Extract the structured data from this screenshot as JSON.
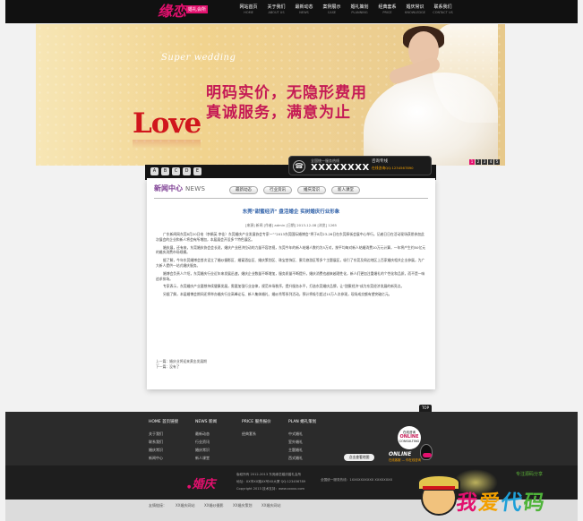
{
  "brand": {
    "logo_script": "缘恋",
    "logo_tag": "婚礼会所",
    "accent": "#e3106e"
  },
  "nav": [
    {
      "cn": "网站首页",
      "en": "HOME"
    },
    {
      "cn": "关于我们",
      "en": "ABOUT US"
    },
    {
      "cn": "最新动态",
      "en": "NEWS"
    },
    {
      "cn": "案例展示",
      "en": "CASE"
    },
    {
      "cn": "婚礼策划",
      "en": "PLANNING"
    },
    {
      "cn": "经典套系",
      "en": "PRICE"
    },
    {
      "cn": "婚庆常识",
      "en": "KNOWLEDGE"
    },
    {
      "cn": "联系我们",
      "en": "CONTACT US"
    }
  ],
  "banner": {
    "super": "Super wedding",
    "line1": "明码实价，无隐形费用",
    "line2": "真诚服务，满意为止",
    "love": "Love",
    "pager": [
      "1",
      "2",
      "3",
      "4",
      "5"
    ]
  },
  "strip": {
    "icons": [
      "A",
      "B",
      "C",
      "D",
      "E"
    ],
    "worktime_label": "全年无休 • WORK TIME",
    "worktime_hours": "AM.8:00-PM.8:00",
    "hotline_label": "全国统一服务热线",
    "hotline_number": "XXXXXXXX",
    "ask_label": "咨询专线",
    "qq_text": "在线咨询QQ:1234567890"
  },
  "news": {
    "title_cn": "新闻中心",
    "title_en": "NEWS",
    "tabs": [
      "最新动态",
      "行业资讯",
      "婚庆常识",
      "新人课堂"
    ],
    "article_title": "东莞\"甜蜜经济\" 盘活婚企 实树婚庆行业形象",
    "article_meta": "[来源] 新闻  [作者] admin  [日期] 2013-12-08  [浏览] 1265",
    "paragraphs": [
      "广东新闻网东莞8月20日电（李娟英 李佳）东莞婚庆产业发展协会专家一”“2013东莞国际婚博会”将于8月23-26日在东莞厚街会展中心举行。记者日日在活动现场获悉参加此次展会的企业和新人将会有所增加，本届展会开设多个特色展区。",
      "婚庆展，还有来，东莞婚庆协会会长说，婚庆产业经济拉动的力量不容忽视，东莞今年的新人结婚人数约为5万对，按平均每对新人结婚消费10万元计算，一年将产生约50亿元的婚庆消费市场规模。",
      "据了解，今年东莞婚博会首次设立了婚纱摄影区、婚宴酒店区、婚庆策划区、珠宝首饰区、蜜月旅游区等多个主题展区，吸引了东莞及周边地区上百家婚庆相关企业参展，为广大新人提供一站式婚庆服务。",
      "婚博会负责人介绍，东莞婚庆行业近年来发展迅速，婚庆企业数量不断增加，服务质量不断提升，婚庆消费也越来越理性化，新人们更加注重婚礼的个性化和品质，而不是一味追求排场。",
      "专家表示，东莞婚庆产业要想持续健康发展，需要加强行业自律，规范市场秩序，提升服务水平，打造东莞婚庆品牌，让\"甜蜜经济\"成为东莞经济发展的新亮点。",
      "另据了解，本届婚博会期间还将举办婚庆行业高峰论坛、新人集体婚礼、婚纱秀等系列活动，预计将吸引超过10万人次参观，现场成交额有望突破亿元。"
    ],
    "prev": "上一篇：婚庆业将迎来黄金发展期",
    "next": "下一篇：没有了"
  },
  "footer": {
    "top_btn": "TOP",
    "columns": [
      {
        "head": "HOME 首页链接",
        "links": [
          "关于我们",
          "联系我们",
          "婚庆常识",
          "新闻中心"
        ]
      },
      {
        "head": "NEWS 新闻",
        "links": [
          "最新动态",
          "行业资讯",
          "婚庆常识",
          "新人课堂"
        ]
      },
      {
        "head": "PRICE 服务报价",
        "links": [
          "经典套系"
        ]
      },
      {
        "head": "PLAN 婚礼策划",
        "links": [
          "中式婚礼",
          "室外婚礼",
          "主题婚礼",
          "西式婚礼"
        ]
      }
    ],
    "online_top": "在线咨询",
    "online_big": "ONLINE",
    "online_sub": "CONSULTING",
    "qr_button": "点击查看地图",
    "online2": "ONLINE",
    "online2_sub": "在线客服 — 你在线咨询"
  },
  "footer2": {
    "logo": "婚庆",
    "line1": "版权所有 2012-2013 东莞缘恋婚庆婚礼会所",
    "line2": "地址：XX市XX路XX号XX大厦 QQ:123456789",
    "line3": "Copyright 2013   技术支持：www.xxxxx.com",
    "hotline": "全国统一服务热线：1XXXXXXXXXX XXXXXXXX"
  },
  "bottom_links": [
    "友情链接：",
    "XX婚庆网站",
    "XX婚纱摄影",
    "XX婚庆策划",
    "XX婚庆网站"
  ],
  "watermark": {
    "text": [
      "我",
      "爱",
      "代",
      "码"
    ],
    "small": "专注源码分享"
  }
}
